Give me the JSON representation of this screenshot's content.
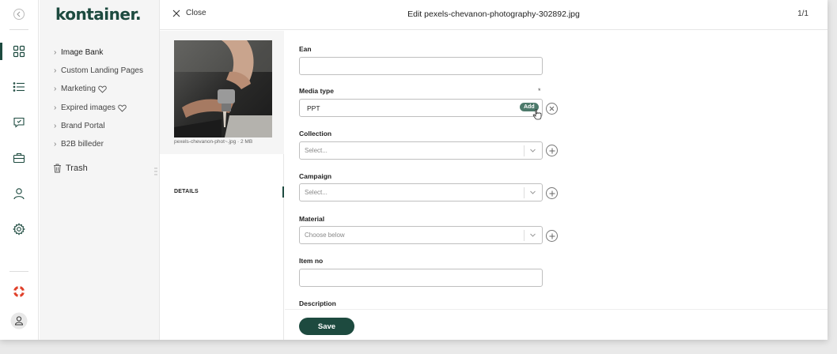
{
  "app": {
    "logo": "kontainer."
  },
  "rail": {
    "icons": [
      "collapse-icon",
      "grid-icon",
      "list-icon",
      "comment-icon",
      "briefcase-icon",
      "user-icon",
      "gear-icon",
      "lifebuoy-icon",
      "account-icon"
    ]
  },
  "nav": {
    "items": [
      {
        "label": "Image Bank",
        "heart": false
      },
      {
        "label": "Custom Landing Pages",
        "heart": false
      },
      {
        "label": "Marketing",
        "heart": true
      },
      {
        "label": "Expired images",
        "heart": true
      },
      {
        "label": "Brand Portal",
        "heart": false
      },
      {
        "label": "B2B billeder",
        "heart": false
      }
    ],
    "trash_label": "Trash"
  },
  "header": {
    "close_label": "Close",
    "title": "Edit pexels-chevanon-photography-302892.jpg",
    "counter": "1/1"
  },
  "preview": {
    "caption": "pexels-chevanon-phot~.jpg · 2 MB",
    "details_tab": "DETAILS"
  },
  "form": {
    "ean": {
      "label": "Ean",
      "value": ""
    },
    "media_type": {
      "label": "Media type",
      "required_mark": "*",
      "value": "PPT",
      "add_badge": "Add"
    },
    "collection": {
      "label": "Collection",
      "placeholder": "Select..."
    },
    "campaign": {
      "label": "Campaign",
      "placeholder": "Select..."
    },
    "material": {
      "label": "Material",
      "placeholder": "Choose below"
    },
    "item_no": {
      "label": "Item no",
      "value": ""
    },
    "description": {
      "label": "Description"
    }
  },
  "footer": {
    "save_label": "Save"
  },
  "colors": {
    "brand": "#1d4a3f",
    "accent_badge": "#4d7a6b",
    "lifebuoy": "#e0412b"
  }
}
